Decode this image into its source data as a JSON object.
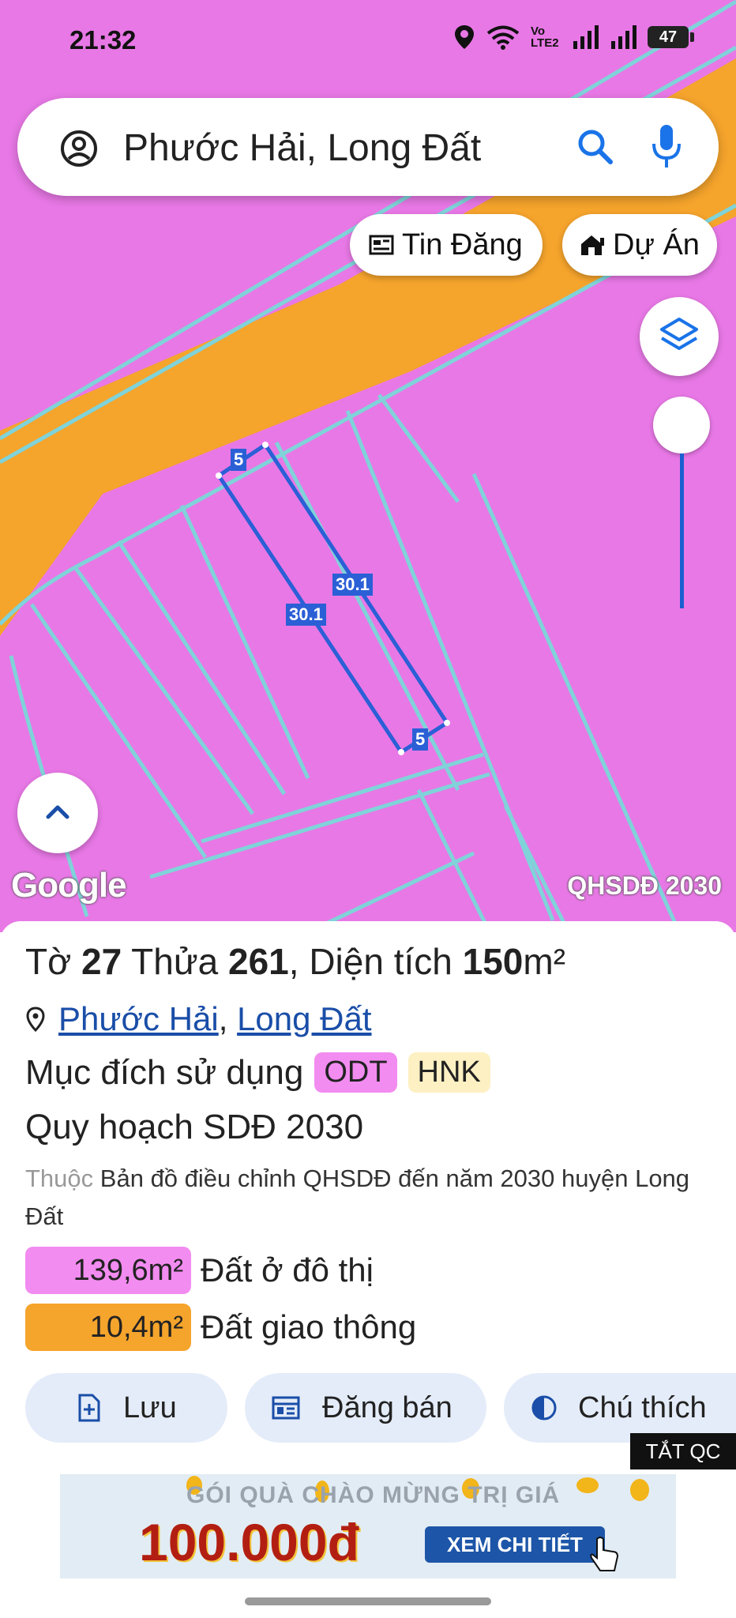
{
  "status": {
    "time": "21:32",
    "network_label": "Vo LTE2",
    "battery": "47"
  },
  "search": {
    "query": "Phước Hải, Long Đất"
  },
  "chips": {
    "listings": "Tin Đăng",
    "projects": "Dự Án"
  },
  "map": {
    "provider_logo": "Google",
    "layer_badge": "QHSDĐ 2030",
    "edge_labels": {
      "top": "5",
      "bottom": "5",
      "left": "30.1",
      "right": "30.1"
    },
    "colors": {
      "residential": "#e878e6",
      "road": "#f5a42c",
      "parcel_line": "#7fd3d9",
      "selection": "#2b5fd6"
    }
  },
  "parcel": {
    "sheet_label": "Tờ",
    "sheet_no": "27",
    "lot_label": "Thửa",
    "lot_no": "261",
    "area_label": "Diện tích",
    "area_value": "150",
    "area_unit": "m²",
    "ward": "Phước Hải",
    "district": "Long Đất",
    "purpose_label": "Mục đích sử dụng",
    "purpose_tags": [
      {
        "code": "ODT",
        "color": "#f28cf0"
      },
      {
        "code": "HNK",
        "color": "#fdf0c2"
      }
    ],
    "plan_title": "Quy hoạch SDĐ 2030",
    "belongs_prefix": "Thuộc",
    "belongs_text": "Bản đồ điều chỉnh QHSDĐ đến năm 2030 huyện Long Đất",
    "breakdown": [
      {
        "value": "139,6m²",
        "label": "Đất ở đô thị",
        "color": "#f28cf0"
      },
      {
        "value": "10,4m²",
        "label": "Đất giao thông",
        "color": "#f5a42c"
      }
    ]
  },
  "actions": {
    "save": "Lưu",
    "post": "Đăng bán",
    "legend": "Chú thích"
  },
  "ad": {
    "close_label": "TẮT QC",
    "headline": "GÓI QUÀ CHÀO MỪNG TRỊ GIÁ",
    "amount": "100.000đ",
    "cta": "XEM CHI TIẾT"
  }
}
